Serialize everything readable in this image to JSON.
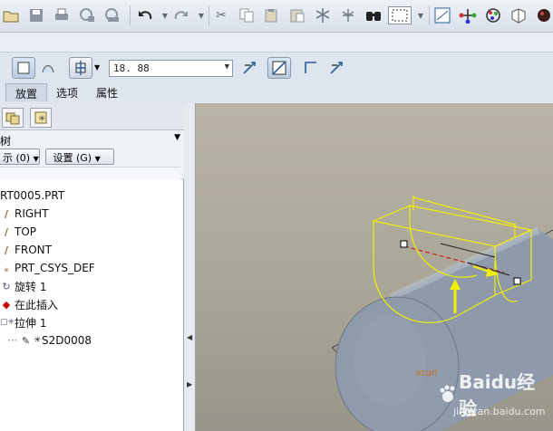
{
  "toolbar": {
    "icons": [
      "folder-open",
      "save",
      "print",
      "mail",
      "send",
      "undo",
      "redo",
      "cut",
      "copy",
      "paste",
      "regenerate",
      "find",
      "select-box",
      "view",
      "datum",
      "analysis",
      "appearance",
      "color"
    ]
  },
  "dashboard": {
    "depth_value": "18. 88",
    "tabs": [
      "放置",
      "选项",
      "属性"
    ]
  },
  "panel": {
    "tree_label": "树",
    "show_button": "示 (0)",
    "settings_button": "设置 (G)",
    "items": [
      {
        "label": "RT0005.PRT",
        "icon": "part-icon"
      },
      {
        "label": "RIGHT",
        "icon": "datum-plane-icon"
      },
      {
        "label": "TOP",
        "icon": "datum-plane-icon"
      },
      {
        "label": "FRONT",
        "icon": "datum-plane-icon"
      },
      {
        "label": "PRT_CSYS_DEF",
        "icon": "csys-icon"
      },
      {
        "label": "旋转 1",
        "icon": "revolve-icon"
      },
      {
        "label": "在此插入",
        "icon": "insert-here-icon"
      },
      {
        "label": "拉伸 1",
        "icon": "extrude-icon"
      },
      {
        "label": "S2D0008",
        "icon": "sketch-icon"
      }
    ]
  },
  "graphics": {
    "datum_label": "RIGHT",
    "watermark_main": "Baidu经验",
    "watermark_url": "jingyan.baidu.com"
  },
  "colors": {
    "accent": "#2a5d9a",
    "sketch_yellow": "#f0f000",
    "cylinder": "#8f9bab"
  }
}
